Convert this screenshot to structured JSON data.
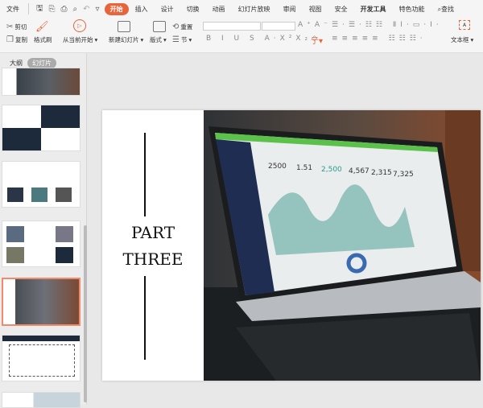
{
  "menubar": {
    "file": "文件",
    "tabs": [
      "开始",
      "插入",
      "设计",
      "切换",
      "动画",
      "幻灯片放映",
      "审阅",
      "视图",
      "安全",
      "开发工具",
      "特色功能"
    ],
    "active": "开始",
    "search": "查找"
  },
  "ribbon": {
    "cut": "剪切",
    "copy": "复制",
    "format_painter": "格式刷",
    "from_current": "从当前开始",
    "new_slide": "新建幻灯片",
    "layout": "版式",
    "reset": "重置",
    "section": "节",
    "textbox": "文本框"
  },
  "panel": {
    "tabs": [
      "大纲",
      "幻灯片"
    ],
    "active": "幻灯片",
    "selected_index": 5
  },
  "slide": {
    "line1": "PART",
    "line2": "THREE",
    "screen_values": [
      "2500",
      "1.51",
      "2,500",
      "4,567",
      "2,315",
      "7,325"
    ]
  },
  "colors": {
    "accent": "#e8643a",
    "selected_border": "#f08a6a"
  }
}
